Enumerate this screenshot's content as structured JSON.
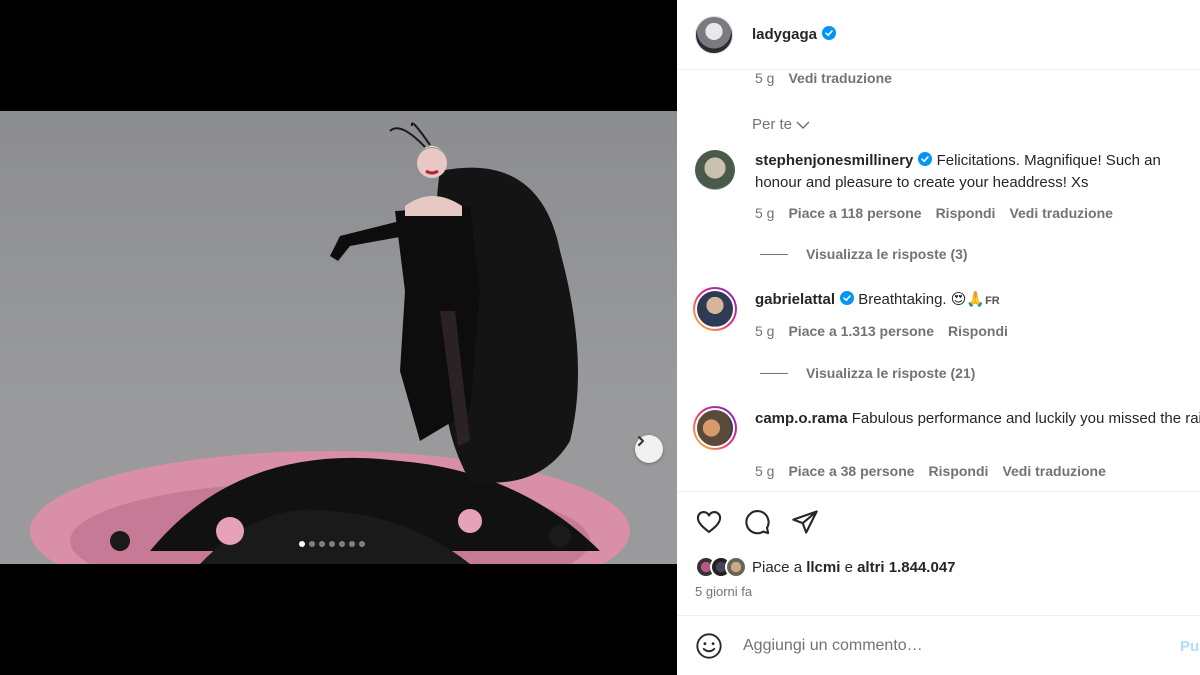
{
  "post": {
    "username": "ladygaga",
    "verified": true,
    "image_alt": "Lady Gaga in black feathered gown",
    "carousel": {
      "count": 7,
      "active_index": 0
    }
  },
  "caption_meta": {
    "time": "5 g",
    "translate": "Vedi traduzione"
  },
  "section_label": "Per te",
  "comments": [
    {
      "username": "stephenjonesmillinery",
      "verified": true,
      "text": "Felicitations. Magnifique! Such an honour and pleasure to create your headdress! Xs",
      "time": "5 g",
      "likes": "Piace a 118 persone",
      "reply": "Rispondi",
      "translate": "Vedi traduzione",
      "view_replies": "Visualizza le risposte (3)"
    },
    {
      "username": "gabrielattal",
      "verified": true,
      "text": "Breathtaking. 😍🙏",
      "lang": "FR",
      "time": "5 g",
      "likes": "Piace a 1.313 persone",
      "reply": "Rispondi",
      "view_replies": "Visualizza le risposte (21)"
    },
    {
      "username": "camp.o.rama",
      "verified": false,
      "text": "Fabulous performance and luckily you missed the rain!",
      "time": "5 g",
      "likes": "Piace a 38 persone",
      "reply": "Rispondi",
      "translate": "Vedi traduzione"
    }
  ],
  "likes_summary": {
    "prefix": "Piace a",
    "user": "llcmi",
    "middle": "e",
    "others": "altri 1.844.047"
  },
  "post_date": "5 giorni fa",
  "comment_input": {
    "placeholder": "Aggiungi un commento…",
    "publish": "Pubblica"
  },
  "colors": {
    "verified": "#0095f6",
    "text": "#262626",
    "muted": "#737373",
    "publish": "#b3dbff"
  },
  "icons": [
    "chevron-right-icon",
    "chevron-down-icon",
    "verified-icon",
    "heart-icon",
    "comment-icon",
    "share-icon",
    "emoji-icon"
  ]
}
